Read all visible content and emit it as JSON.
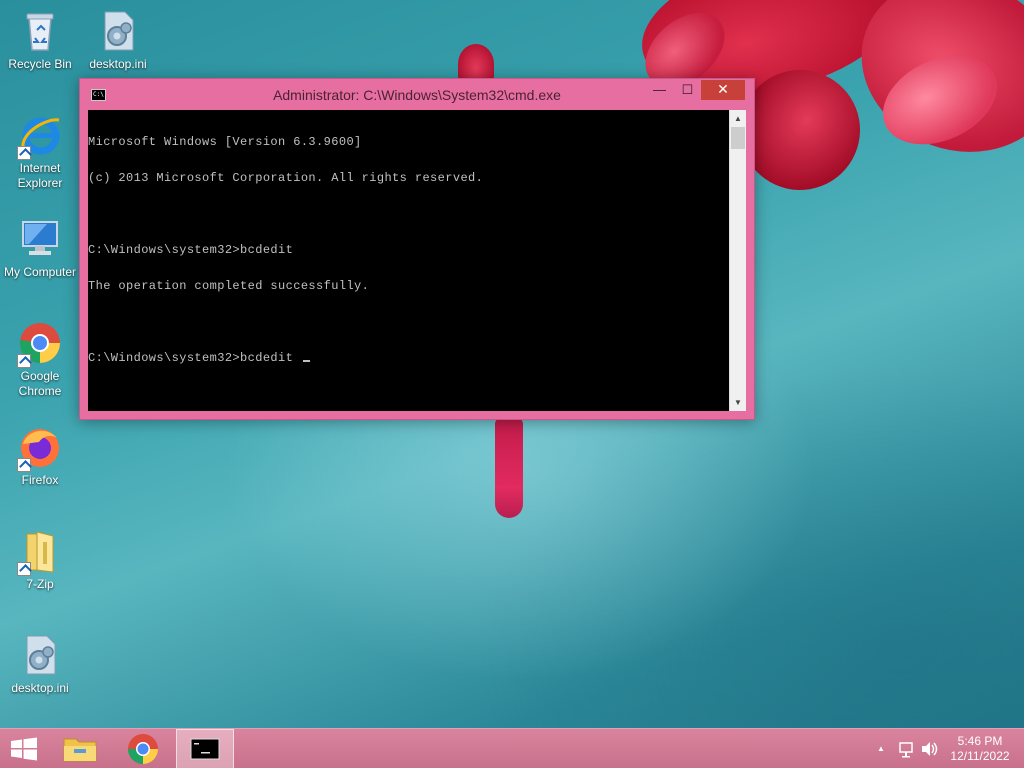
{
  "desktop_icons": [
    {
      "label": "Recycle Bin",
      "icon": "recycle-bin-icon"
    },
    {
      "label": "desktop.ini",
      "icon": "settings-file-icon"
    },
    {
      "label_line1": "Internet",
      "label_line2": "Explorer",
      "icon": "internet-explorer-icon"
    },
    {
      "label": "My Computer",
      "icon": "computer-icon"
    },
    {
      "label_line1": "Google",
      "label_line2": "Chrome",
      "icon": "chrome-icon"
    },
    {
      "label": "Firefox",
      "icon": "firefox-icon"
    },
    {
      "label": "7-Zip",
      "icon": "folder-zip-icon"
    },
    {
      "label": "desktop.ini",
      "icon": "settings-file-icon"
    }
  ],
  "window": {
    "title": "Administrator: C:\\Windows\\System32\\cmd.exe",
    "icon_text": "C:\\",
    "minimize": "—",
    "maximize": "☐",
    "close": "✕",
    "lines": [
      "Microsoft Windows [Version 6.3.9600]",
      "(c) 2013 Microsoft Corporation. All rights reserved.",
      "",
      "C:\\Windows\\system32>bcdedit",
      "The operation completed successfully.",
      "",
      "C:\\Windows\\system32>bcdedit "
    ]
  },
  "taskbar": {
    "clock_time": "5:46 PM",
    "clock_date": "12/11/2022",
    "tray_arrow": "▲"
  },
  "colors": {
    "window_frame": "#e76ea0",
    "close_button": "#c7403a",
    "taskbar": "#d07892"
  }
}
